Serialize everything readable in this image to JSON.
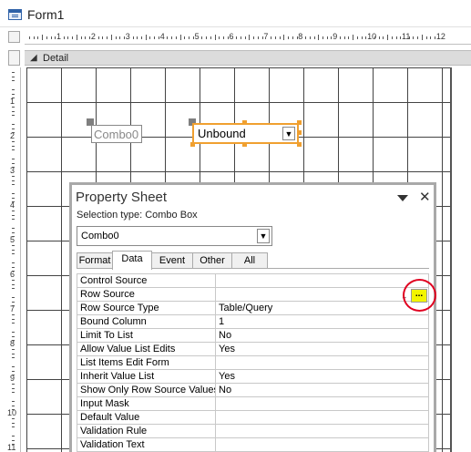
{
  "window": {
    "title": "Form1",
    "icon": "form-icon"
  },
  "ruler": {
    "horizontal_numbers": [
      "1",
      "2",
      "3",
      "4",
      "5",
      "6",
      "7",
      "8",
      "9",
      "10",
      "11",
      "12"
    ],
    "vertical_numbers": [
      "1",
      "2",
      "3",
      "4",
      "5",
      "6",
      "7",
      "8",
      "9",
      "10",
      "11"
    ]
  },
  "section": {
    "label": "Detail",
    "toggle_icon": "chevron-down-icon"
  },
  "design_controls": {
    "label_text": "Combo0",
    "combo_value": "Unbound",
    "combo_arrow_icon": "dropdown-arrow-icon"
  },
  "property_sheet": {
    "title": "Property Sheet",
    "selection_type": "Selection type:  Combo Box",
    "selector_value": "Combo0",
    "tabs": [
      "Format",
      "Data",
      "Event",
      "Other",
      "All"
    ],
    "active_tab": "Data",
    "rows": [
      {
        "name": "Control Source",
        "value": ""
      },
      {
        "name": "Row Source",
        "value": ""
      },
      {
        "name": "Row Source Type",
        "value": "Table/Query"
      },
      {
        "name": "Bound Column",
        "value": "1"
      },
      {
        "name": "Limit To List",
        "value": "No"
      },
      {
        "name": "Allow Value List Edits",
        "value": "Yes"
      },
      {
        "name": "List Items Edit Form",
        "value": ""
      },
      {
        "name": "Inherit Value List",
        "value": "Yes"
      },
      {
        "name": "Show Only Row Source Values",
        "value": "No"
      },
      {
        "name": "Input Mask",
        "value": ""
      },
      {
        "name": "Default Value",
        "value": ""
      },
      {
        "name": "Validation Rule",
        "value": ""
      },
      {
        "name": "Validation Text",
        "value": ""
      }
    ],
    "builder_button_label": "...",
    "highlight_color": "#f3f500",
    "annotation_color": "#e00020"
  }
}
